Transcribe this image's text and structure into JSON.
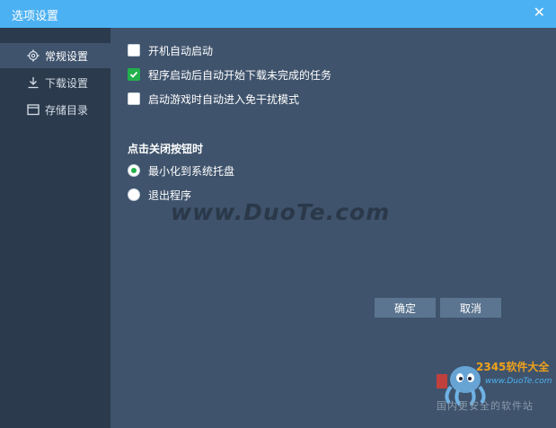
{
  "window": {
    "title": "选项设置",
    "close_label": "✕"
  },
  "sidebar": {
    "items": [
      {
        "label": "常规设置",
        "icon": "gear-icon",
        "active": true
      },
      {
        "label": "下载设置",
        "icon": "download-icon",
        "active": false
      },
      {
        "label": "存储目录",
        "icon": "folder-icon",
        "active": false
      }
    ]
  },
  "general": {
    "checkboxes": [
      {
        "label": "开机自动启动",
        "checked": false
      },
      {
        "label": "程序启动后自动开始下载未完成的任务",
        "checked": true
      },
      {
        "label": "启动游戏时自动进入免干扰模式",
        "checked": false
      }
    ],
    "close_section_title": "点击关闭按钮时",
    "close_options": [
      {
        "label": "最小化到系统托盘",
        "selected": true
      },
      {
        "label": "退出程序",
        "selected": false
      }
    ]
  },
  "buttons": {
    "ok_label": "确定",
    "cancel_label": "取消"
  },
  "watermark": {
    "site": "www.DuoTe.com",
    "logo_line1": "2345软件大全",
    "logo_line2": "www.DuoTe.com",
    "logo_line3": "国内更安全的软件站"
  },
  "colors": {
    "titlebar": "#4cb1f2",
    "sidebar": "#2b3a4c",
    "main": "#3f536c",
    "accent": "#22b14c",
    "button": "#5b7590"
  }
}
